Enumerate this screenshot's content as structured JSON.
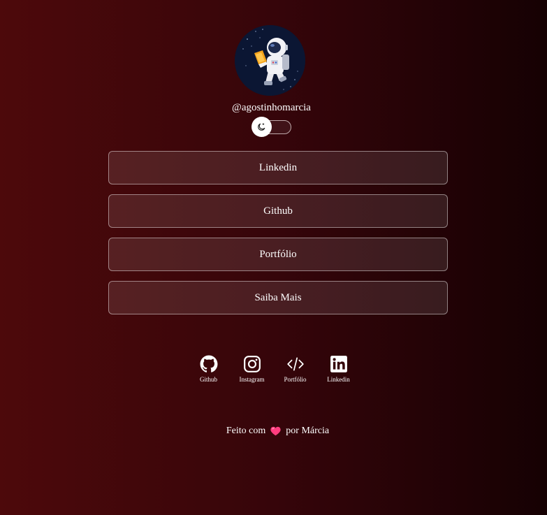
{
  "profile": {
    "username": "@agostinhomarcia",
    "avatar_icon": "astronaut-avatar"
  },
  "theme_toggle": {
    "icon": "moon-sun-icon",
    "state": "off"
  },
  "links": [
    {
      "label": "Linkedin"
    },
    {
      "label": "Github"
    },
    {
      "label": "Portfólio"
    },
    {
      "label": "Saiba Mais"
    }
  ],
  "socials": [
    {
      "label": "Github",
      "icon": "github-icon"
    },
    {
      "label": "Instagram",
      "icon": "instagram-icon"
    },
    {
      "label": "Portfólio",
      "icon": "code-icon"
    },
    {
      "label": "Linkedin",
      "icon": "linkedin-icon"
    }
  ],
  "footer": {
    "prefix": "Feito com",
    "suffix": "por Márcia",
    "heart_color": "#ff3d7f"
  },
  "colors": {
    "background_start": "#4d090b",
    "background_end": "#160103"
  }
}
